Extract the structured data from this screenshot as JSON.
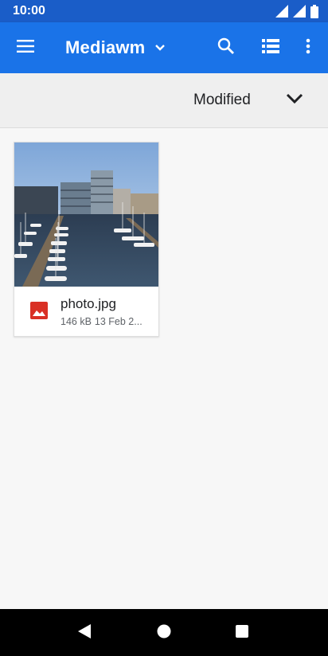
{
  "status_bar": {
    "time": "10:00"
  },
  "app_bar": {
    "title": "Mediawm"
  },
  "sort_bar": {
    "label": "Modified"
  },
  "files": [
    {
      "name": "photo.jpg",
      "size": "146 kB",
      "date": "13 Feb 2..."
    }
  ],
  "colors": {
    "status_bar": "#1a5dc8",
    "app_bar": "#1a73e8",
    "image_icon": "#d93025",
    "nav_bar": "#000000"
  },
  "icons": {
    "menu": "hamburger-menu-icon",
    "dropdown": "chevron-down-icon",
    "search": "search-icon",
    "view": "list-view-icon",
    "more": "more-vert-icon",
    "file_type": "image-icon",
    "back": "back-icon",
    "home": "home-icon",
    "recents": "recents-icon"
  }
}
